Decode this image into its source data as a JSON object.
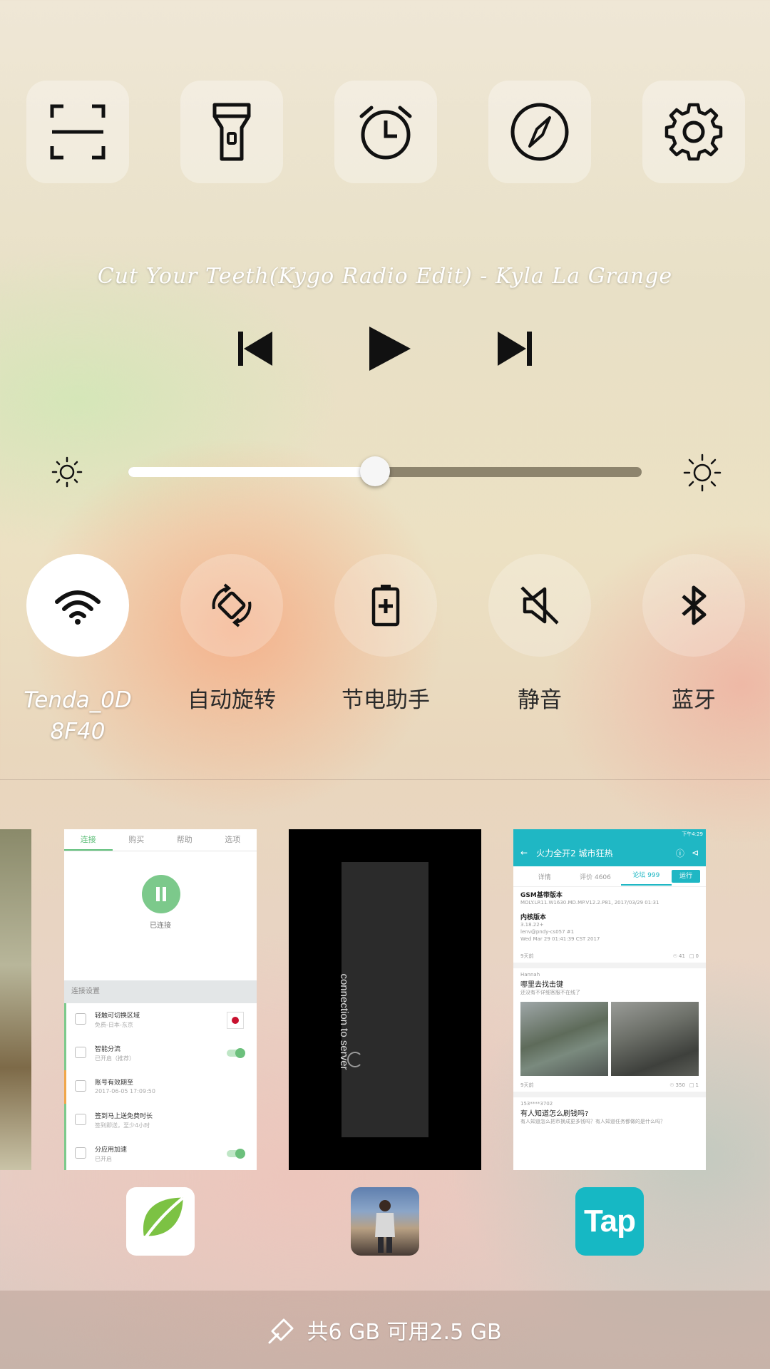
{
  "tools": [
    {
      "icon": "scan-icon"
    },
    {
      "icon": "flashlight-icon"
    },
    {
      "icon": "alarm-clock-icon"
    },
    {
      "icon": "compass-icon"
    },
    {
      "icon": "gear-icon"
    }
  ],
  "music": {
    "song": "Cut Your Teeth(Kygo Radio Edit) - Kyla La Grange"
  },
  "brightness": {
    "level": 0.48
  },
  "toggles": [
    {
      "label": "Tenda_0D 8F40",
      "icon": "wifi-icon",
      "on": true
    },
    {
      "label": "自动旋转",
      "icon": "auto-rotate-icon",
      "on": false
    },
    {
      "label": "节电助手",
      "icon": "battery-saver-icon",
      "on": false
    },
    {
      "label": "静音",
      "icon": "mute-icon",
      "on": false
    },
    {
      "label": "蓝牙",
      "icon": "bluetooth-icon",
      "on": false
    }
  ],
  "recents": {
    "vpn": {
      "tabs": [
        "连接",
        "购买",
        "帮助",
        "选项"
      ],
      "status": "已连接",
      "section": "连接设置",
      "rows": [
        {
          "title": "轻触可切换区域",
          "sub": "免费-日本-东京"
        },
        {
          "title": "智能分流",
          "sub": "已开启（推荐）"
        },
        {
          "title": "账号有效期至",
          "sub": "2017-06-05 17:09:50"
        },
        {
          "title": "签到马上送免费时长",
          "sub": "签到即送，至少4小时"
        },
        {
          "title": "分应用加速",
          "sub": "已开启"
        }
      ]
    },
    "game": {
      "message": "connection to server"
    },
    "forum": {
      "status_time": "下午4:29",
      "title": "火力全开2 城市狂热",
      "tabs": [
        "详情",
        "评价 4606",
        "论坛 999"
      ],
      "action": "运行",
      "post1_title": "GSM基带版本",
      "post1_line": "MOLY.LR11.W1630.MD.MP.V12.2.P81, 2017/03/29 01:31",
      "post1_kernel_title": "内核版本",
      "post1_kernel": "3.18.22+",
      "post1_kernel2": "lenv@pndy-cs057 #1",
      "post1_kernel3": "Wed Mar 29 01:41:39 CST 2017",
      "post1_time": "9天前",
      "post1_views": "41",
      "post1_comments": "0",
      "post2_user": "Hannah",
      "post2_title": "哪里去找击键",
      "post2_sub": "还没有不详细客服不在线了",
      "post2_time": "9天前",
      "post2_views": "350",
      "post2_comments": "1",
      "post3_user": "153****3702",
      "post3_title": "有人知道怎么刷钱吗?",
      "post3_sub": "有人知道怎么把币换成更多钱吗？有人知道任务都做的是什么吗？"
    }
  },
  "dock": [
    {
      "icon": "leaf-vpn-app-icon"
    },
    {
      "icon": "game-app-icon"
    },
    {
      "icon": "taptap-app-icon",
      "label": "Tap"
    }
  ],
  "storage": {
    "text": "共6 GB 可用2.5 GB"
  }
}
